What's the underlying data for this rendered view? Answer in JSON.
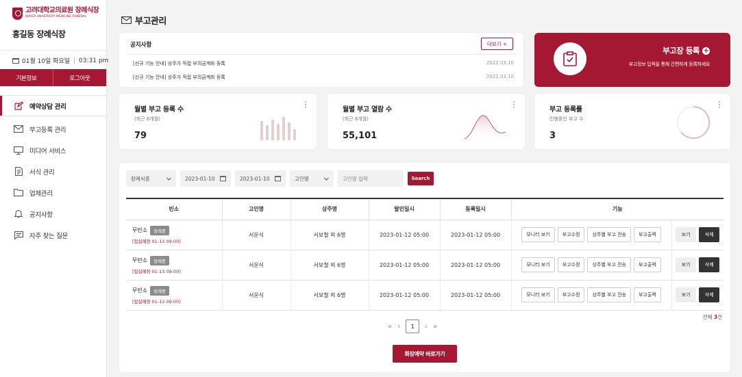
{
  "brand": {
    "logo_ko": "고려대학교의료원 장례식장",
    "logo_en": "KOREA UNIVERSITY MEDICINE FUNERAL",
    "site_name": "홍길동 장례식장"
  },
  "header_info": {
    "date": "01월 10일 화요일",
    "time": "03:31 pm"
  },
  "account_buttons": {
    "info": "기본정보",
    "logout": "로그아웃"
  },
  "nav": [
    {
      "label": "예약상담 관리",
      "icon": "edit-icon"
    },
    {
      "label": "부고등록 관리",
      "icon": "envelope-icon"
    },
    {
      "label": "미디어 서비스",
      "icon": "monitor-icon"
    },
    {
      "label": "서식 관리",
      "icon": "document-icon"
    },
    {
      "label": "업체관리",
      "icon": "folder-icon"
    },
    {
      "label": "공지사항",
      "icon": "bell-icon"
    },
    {
      "label": "자주 찾는 질문",
      "icon": "chat-icon"
    }
  ],
  "page_title": "부고관리",
  "notice": {
    "title": "공지사항",
    "more": "더보기 +",
    "items": [
      {
        "text": "[신규 기능 안내] 상주가 직접 부의금계좌 등록",
        "date": "2022.03.10"
      },
      {
        "text": "[신규 기능 안내] 상주가 직접 부의금계좌 등록",
        "date": "2022.03.10"
      }
    ]
  },
  "register": {
    "title": "부고장 등록",
    "plus": "+",
    "sub": "부고정보 입력을 통해 간편하게 등록하세요"
  },
  "stats": [
    {
      "title": "월별 부고 등록 수",
      "sub": "(최근 6개월)",
      "value": "79"
    },
    {
      "title": "월별 부고 열람 수",
      "sub": "(최근 6개월)",
      "value": "55,101"
    },
    {
      "title": "부고 등록률",
      "sub": "진행중인 부고 수",
      "value": "3"
    }
  ],
  "filters": {
    "hall": "장례식중",
    "date_from": "2023-01-10",
    "date_to": "2023-01-10",
    "field": "고인명",
    "keyword_placeholder": "고인명 입력",
    "search": "Search"
  },
  "table": {
    "headers": [
      "빈소",
      "고인명",
      "상주명",
      "발인일시",
      "등록일시",
      "기능"
    ],
    "rows": [
      {
        "bin": "무빈소",
        "tag": "장례중",
        "plan": "[입실예정 01-13 09:00]",
        "deceased": "서운식",
        "chief": "서보철 외 6명",
        "departure": "2023-01-12 05:00",
        "registered": "2023-01-12 05:00"
      },
      {
        "bin": "무빈소",
        "tag": "장례중",
        "plan": "[입실예정 01-13 09:00]",
        "deceased": "서운식",
        "chief": "서보철 외 6명",
        "departure": "2023-01-12 05:00",
        "registered": "2023-01-12 05:00"
      },
      {
        "bin": "무빈소",
        "tag": "장례중",
        "plan": "[입실예정 01-13 09:00]",
        "deceased": "서운식",
        "chief": "서보철 외 6명",
        "departure": "2023-01-12 05:00",
        "registered": "2023-01-12 05:00"
      }
    ],
    "actions": {
      "monitor": "모니터 보기",
      "edit": "부고수정",
      "send": "상주별 부고 전송",
      "print": "부고출력",
      "view": "보기",
      "delete": "삭제"
    }
  },
  "total": {
    "prefix": "전체 ",
    "count": "3",
    "suffix": "건"
  },
  "pagination": {
    "first": "«",
    "prev": "‹",
    "current": "1",
    "next": "›",
    "last": "»"
  },
  "go_button": "화장예약 바로가기",
  "colors": {
    "brand": "#a51834",
    "background": "#f3f3f3"
  }
}
